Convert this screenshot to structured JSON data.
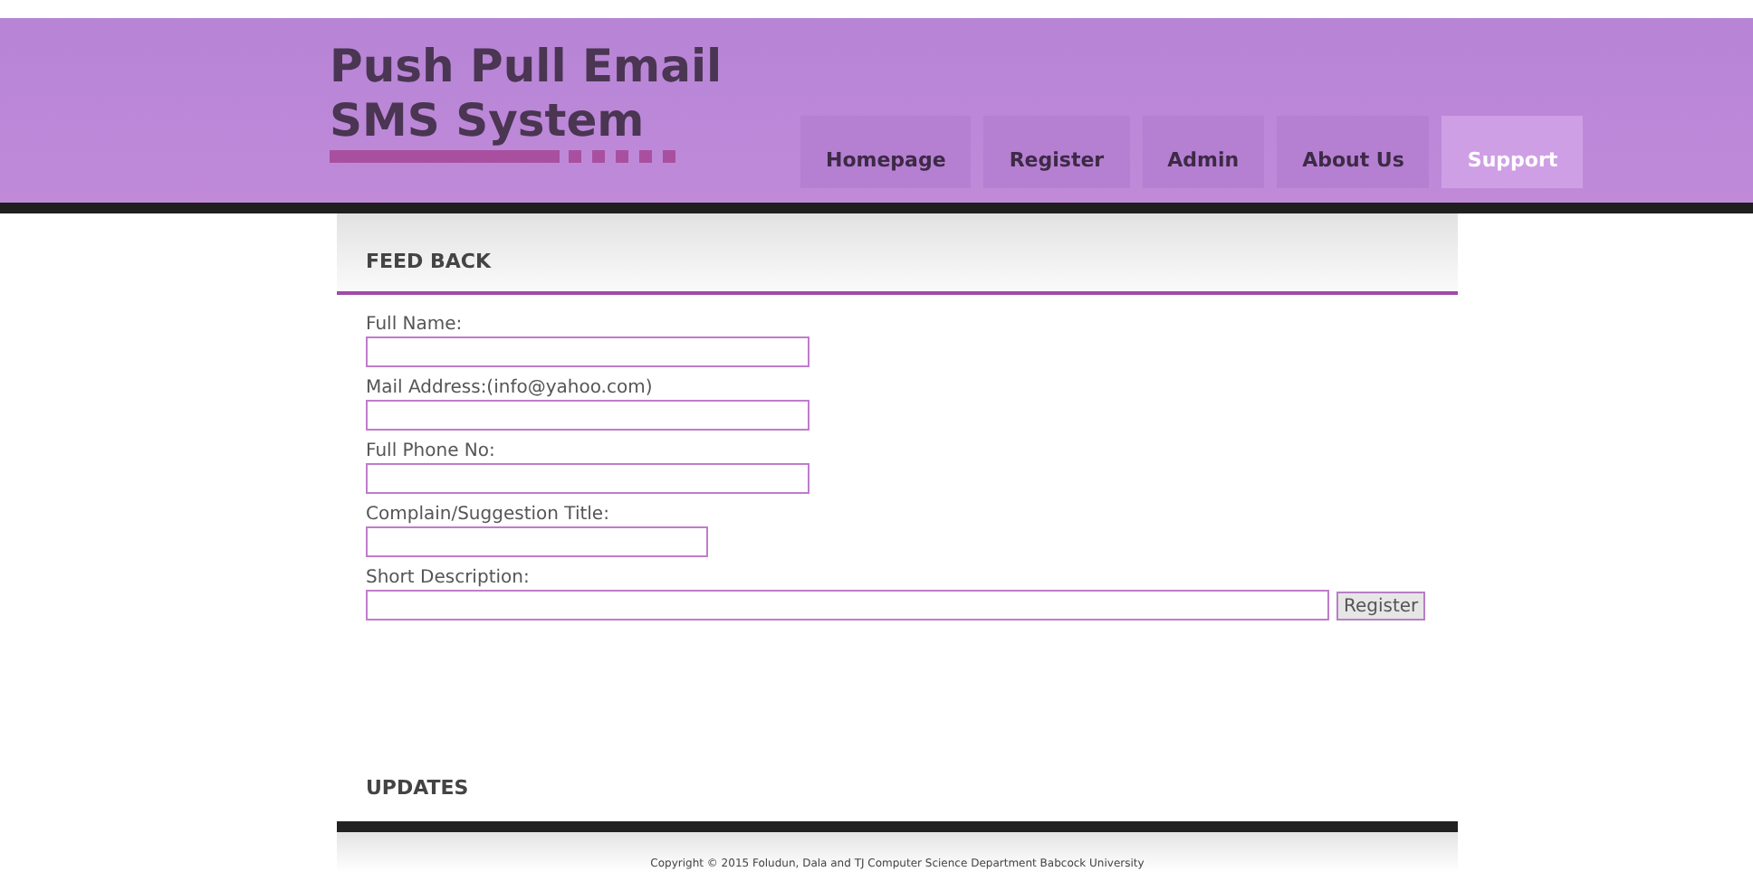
{
  "site": {
    "title_line_1": "Push Pull Email",
    "title_line_2": "SMS System"
  },
  "nav": [
    {
      "label": "Homepage",
      "selected": false
    },
    {
      "label": "Register",
      "selected": false
    },
    {
      "label": "Admin",
      "selected": false
    },
    {
      "label": "About Us",
      "selected": false
    },
    {
      "label": "Support",
      "selected": true
    }
  ],
  "feedback": {
    "heading": "FEED BACK",
    "fields": [
      {
        "label": "Full Name:",
        "kind": "text"
      },
      {
        "label": "Mail Address:(info@yahoo.com)",
        "kind": "text"
      },
      {
        "label": "Full Phone No:",
        "kind": "text"
      },
      {
        "label": "Complain/Suggestion Title:",
        "kind": "title"
      },
      {
        "label": "Short Description:",
        "kind": "description"
      }
    ],
    "submit": "Register"
  },
  "updates": {
    "heading": "UPDATES"
  },
  "footer": "Copyright © 2015 Foludun, Dala and TJ Computer Science Department Babcock University"
}
